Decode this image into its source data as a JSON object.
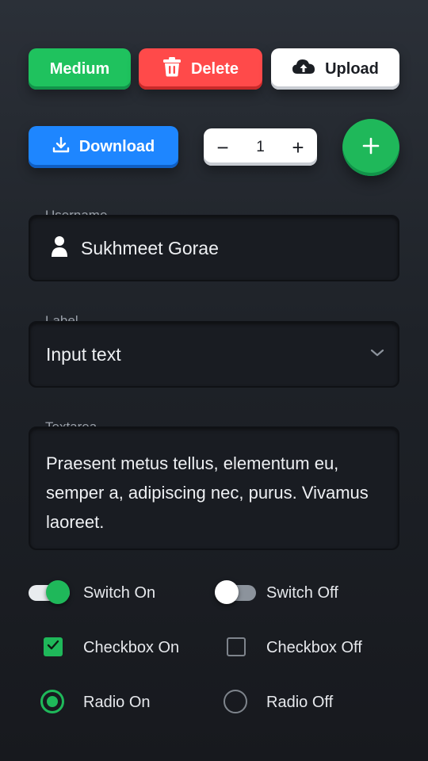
{
  "buttons": {
    "medium": "Medium",
    "delete": "Delete",
    "upload": "Upload",
    "download": "Download"
  },
  "stepper": {
    "value": "1",
    "minus": "−",
    "plus": "+"
  },
  "username": {
    "label": "Username",
    "value": "Sukhmeet Gorae",
    "icon": "user-icon"
  },
  "select": {
    "label": "Label",
    "value": "Input text",
    "icon": "chevron-down-icon"
  },
  "textarea": {
    "label": "Textarea",
    "value": "Praesent metus tellus, elementum eu, semper a, adipiscing nec, purus. Vivamus laoreet."
  },
  "controls": {
    "switch_on": "Switch On",
    "switch_off": "Switch Off",
    "checkbox_on": "Checkbox On",
    "checkbox_off": "Checkbox Off",
    "radio_on": "Radio On",
    "radio_off": "Radio Off"
  },
  "colors": {
    "green": "#1fc25e",
    "red": "#ff4a4a",
    "blue": "#1e86ff",
    "white": "#ffffff"
  }
}
